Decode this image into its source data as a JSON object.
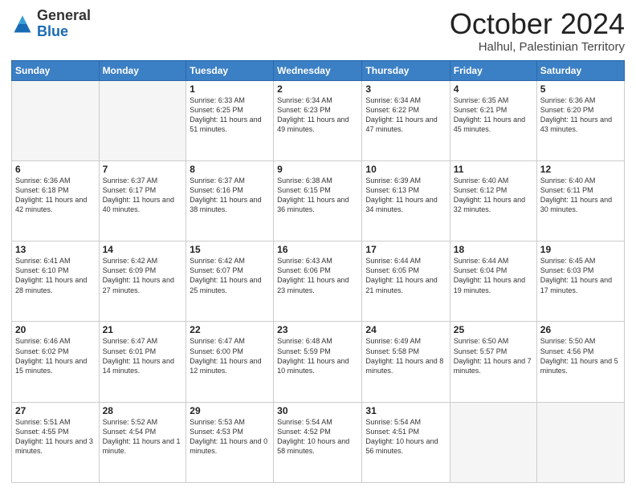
{
  "logo": {
    "general": "General",
    "blue": "Blue"
  },
  "header": {
    "month": "October 2024",
    "location": "Halhul, Palestinian Territory"
  },
  "days_of_week": [
    "Sunday",
    "Monday",
    "Tuesday",
    "Wednesday",
    "Thursday",
    "Friday",
    "Saturday"
  ],
  "weeks": [
    [
      {
        "day": "",
        "info": ""
      },
      {
        "day": "",
        "info": ""
      },
      {
        "day": "1",
        "info": "Sunrise: 6:33 AM\nSunset: 6:25 PM\nDaylight: 11 hours and 51 minutes."
      },
      {
        "day": "2",
        "info": "Sunrise: 6:34 AM\nSunset: 6:23 PM\nDaylight: 11 hours and 49 minutes."
      },
      {
        "day": "3",
        "info": "Sunrise: 6:34 AM\nSunset: 6:22 PM\nDaylight: 11 hours and 47 minutes."
      },
      {
        "day": "4",
        "info": "Sunrise: 6:35 AM\nSunset: 6:21 PM\nDaylight: 11 hours and 45 minutes."
      },
      {
        "day": "5",
        "info": "Sunrise: 6:36 AM\nSunset: 6:20 PM\nDaylight: 11 hours and 43 minutes."
      }
    ],
    [
      {
        "day": "6",
        "info": "Sunrise: 6:36 AM\nSunset: 6:18 PM\nDaylight: 11 hours and 42 minutes."
      },
      {
        "day": "7",
        "info": "Sunrise: 6:37 AM\nSunset: 6:17 PM\nDaylight: 11 hours and 40 minutes."
      },
      {
        "day": "8",
        "info": "Sunrise: 6:37 AM\nSunset: 6:16 PM\nDaylight: 11 hours and 38 minutes."
      },
      {
        "day": "9",
        "info": "Sunrise: 6:38 AM\nSunset: 6:15 PM\nDaylight: 11 hours and 36 minutes."
      },
      {
        "day": "10",
        "info": "Sunrise: 6:39 AM\nSunset: 6:13 PM\nDaylight: 11 hours and 34 minutes."
      },
      {
        "day": "11",
        "info": "Sunrise: 6:40 AM\nSunset: 6:12 PM\nDaylight: 11 hours and 32 minutes."
      },
      {
        "day": "12",
        "info": "Sunrise: 6:40 AM\nSunset: 6:11 PM\nDaylight: 11 hours and 30 minutes."
      }
    ],
    [
      {
        "day": "13",
        "info": "Sunrise: 6:41 AM\nSunset: 6:10 PM\nDaylight: 11 hours and 28 minutes."
      },
      {
        "day": "14",
        "info": "Sunrise: 6:42 AM\nSunset: 6:09 PM\nDaylight: 11 hours and 27 minutes."
      },
      {
        "day": "15",
        "info": "Sunrise: 6:42 AM\nSunset: 6:07 PM\nDaylight: 11 hours and 25 minutes."
      },
      {
        "day": "16",
        "info": "Sunrise: 6:43 AM\nSunset: 6:06 PM\nDaylight: 11 hours and 23 minutes."
      },
      {
        "day": "17",
        "info": "Sunrise: 6:44 AM\nSunset: 6:05 PM\nDaylight: 11 hours and 21 minutes."
      },
      {
        "day": "18",
        "info": "Sunrise: 6:44 AM\nSunset: 6:04 PM\nDaylight: 11 hours and 19 minutes."
      },
      {
        "day": "19",
        "info": "Sunrise: 6:45 AM\nSunset: 6:03 PM\nDaylight: 11 hours and 17 minutes."
      }
    ],
    [
      {
        "day": "20",
        "info": "Sunrise: 6:46 AM\nSunset: 6:02 PM\nDaylight: 11 hours and 15 minutes."
      },
      {
        "day": "21",
        "info": "Sunrise: 6:47 AM\nSunset: 6:01 PM\nDaylight: 11 hours and 14 minutes."
      },
      {
        "day": "22",
        "info": "Sunrise: 6:47 AM\nSunset: 6:00 PM\nDaylight: 11 hours and 12 minutes."
      },
      {
        "day": "23",
        "info": "Sunrise: 6:48 AM\nSunset: 5:59 PM\nDaylight: 11 hours and 10 minutes."
      },
      {
        "day": "24",
        "info": "Sunrise: 6:49 AM\nSunset: 5:58 PM\nDaylight: 11 hours and 8 minutes."
      },
      {
        "day": "25",
        "info": "Sunrise: 6:50 AM\nSunset: 5:57 PM\nDaylight: 11 hours and 7 minutes."
      },
      {
        "day": "26",
        "info": "Sunrise: 5:50 AM\nSunset: 4:56 PM\nDaylight: 11 hours and 5 minutes."
      }
    ],
    [
      {
        "day": "27",
        "info": "Sunrise: 5:51 AM\nSunset: 4:55 PM\nDaylight: 11 hours and 3 minutes."
      },
      {
        "day": "28",
        "info": "Sunrise: 5:52 AM\nSunset: 4:54 PM\nDaylight: 11 hours and 1 minute."
      },
      {
        "day": "29",
        "info": "Sunrise: 5:53 AM\nSunset: 4:53 PM\nDaylight: 11 hours and 0 minutes."
      },
      {
        "day": "30",
        "info": "Sunrise: 5:54 AM\nSunset: 4:52 PM\nDaylight: 10 hours and 58 minutes."
      },
      {
        "day": "31",
        "info": "Sunrise: 5:54 AM\nSunset: 4:51 PM\nDaylight: 10 hours and 56 minutes."
      },
      {
        "day": "",
        "info": ""
      },
      {
        "day": "",
        "info": ""
      }
    ]
  ]
}
